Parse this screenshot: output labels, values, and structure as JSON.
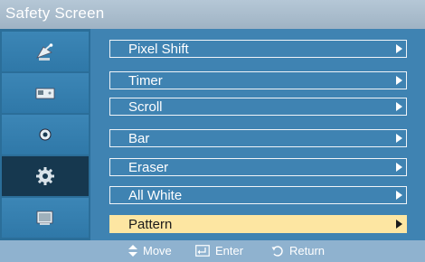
{
  "title": "Safety Screen",
  "sidebar": {
    "items": [
      {
        "icon": "satellite-dish-icon",
        "selected": false
      },
      {
        "icon": "picture-input-icon",
        "selected": false
      },
      {
        "icon": "sound-icon",
        "selected": false
      },
      {
        "icon": "gear-icon",
        "selected": true
      },
      {
        "icon": "multi-screen-icon",
        "selected": false
      }
    ]
  },
  "menu": {
    "items": [
      {
        "label": "Pixel Shift",
        "selected": false
      },
      {
        "label": "Timer",
        "selected": false
      },
      {
        "label": "Scroll",
        "selected": false
      },
      {
        "label": "Bar",
        "selected": false
      },
      {
        "label": "Eraser",
        "selected": false
      },
      {
        "label": "All White",
        "selected": false
      },
      {
        "label": "Pattern",
        "selected": true
      }
    ]
  },
  "footer": {
    "move": "Move",
    "enter": "Enter",
    "return": "Return"
  },
  "colors": {
    "panel": "#3f83b2",
    "sidebar_selected": "#16384f",
    "highlight": "#fde6a2",
    "titlebar": "#a9bccc",
    "footer": "#8fb2cf"
  }
}
